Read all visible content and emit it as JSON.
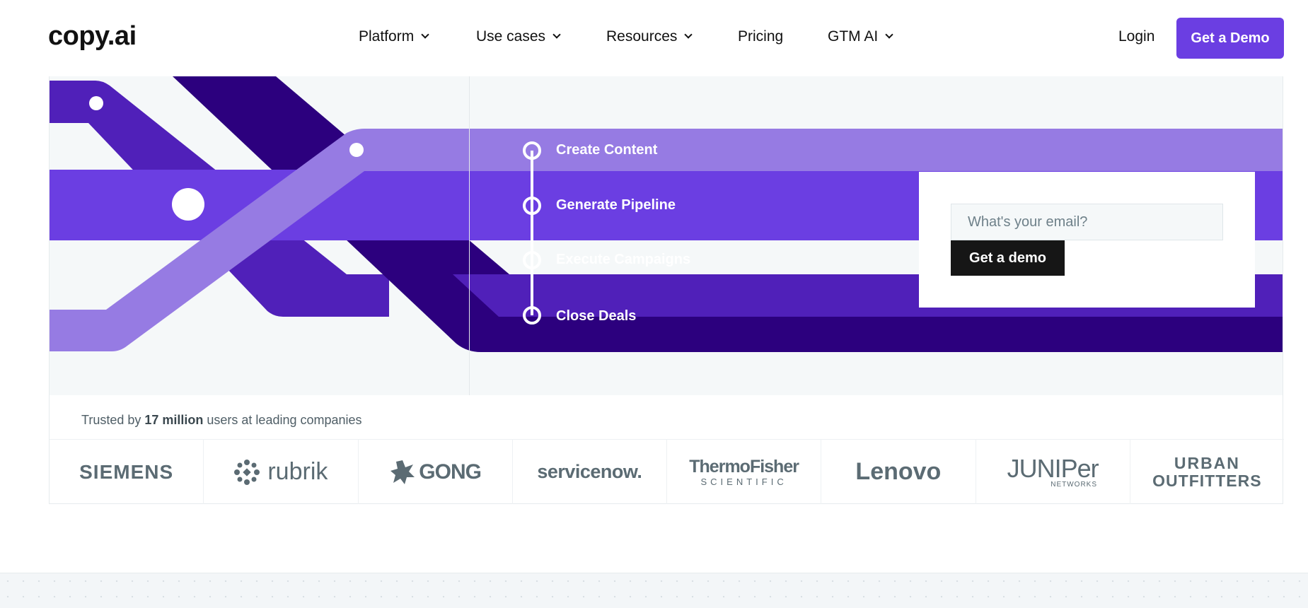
{
  "nav": {
    "logo": "copy.ai",
    "items": [
      {
        "label": "Platform",
        "has_dropdown": true
      },
      {
        "label": "Use cases",
        "has_dropdown": true
      },
      {
        "label": "Resources",
        "has_dropdown": true
      },
      {
        "label": "Pricing",
        "has_dropdown": false
      },
      {
        "label": "GTM AI",
        "has_dropdown": true
      }
    ],
    "login": "Login",
    "cta": "Get a Demo"
  },
  "hero": {
    "steps": [
      "Create Content",
      "Generate Pipeline",
      "Execute Campaigns",
      "Close Deals"
    ],
    "email_placeholder": "What's your email?",
    "email_cta": "Get a demo"
  },
  "trusted": {
    "prefix": "Trusted by ",
    "highlight": "17 million",
    "suffix": " users at leading companies",
    "logos": [
      "SIEMENS",
      "rubrik",
      "GONG",
      "servicenow.",
      "ThermoFisher",
      "SCIENTIFIC",
      "Lenovo",
      "JUNIPer",
      "NETWORKS",
      "URBAN",
      "OUTFITTERS"
    ]
  },
  "colors": {
    "accent": "#6b3ee2",
    "light_purple": "#967be3",
    "mid_purple": "#5020b9",
    "dark_purple": "#2c007e",
    "logo_gray": "#5b6b73"
  }
}
